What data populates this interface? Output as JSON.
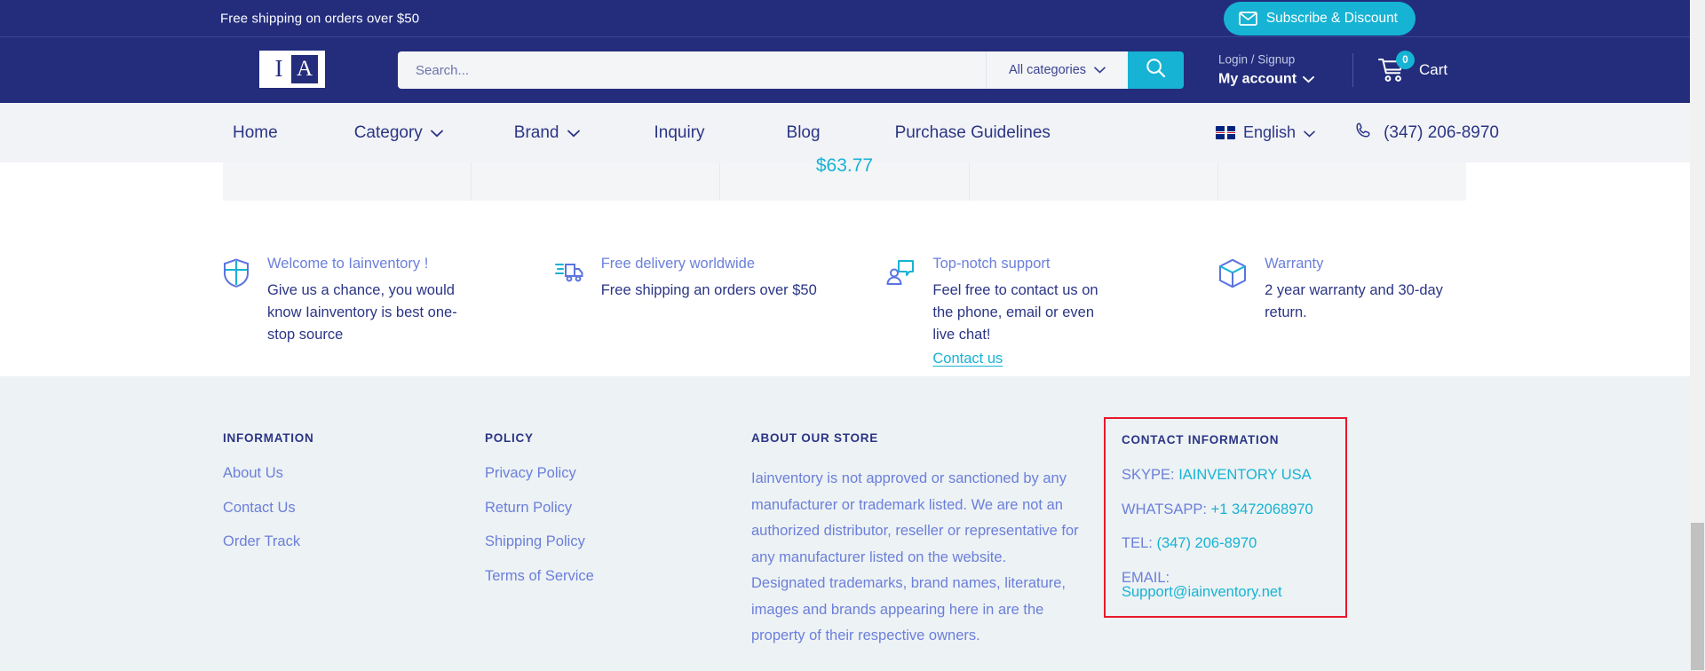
{
  "announcement": {
    "text": "Free shipping on orders over $50",
    "subscribe_label": "Subscribe & Discount",
    "mail_icon": "envelope-icon"
  },
  "header": {
    "logo_left": "I",
    "logo_right": "A",
    "search_placeholder": "Search...",
    "search_value": "",
    "category_label": "All categories",
    "search_icon": "magnifier-icon",
    "account_top": "Login / Signup",
    "account_bottom": "My account",
    "cart_label": "Cart",
    "cart_count": "0"
  },
  "nav": {
    "items": [
      {
        "label": "Home",
        "caret": false
      },
      {
        "label": "Category",
        "caret": true
      },
      {
        "label": "Brand",
        "caret": true
      },
      {
        "label": "Inquiry",
        "caret": false
      },
      {
        "label": "Blog",
        "caret": false
      },
      {
        "label": "Purchase Guidelines",
        "caret": false
      }
    ],
    "language": "English",
    "phone": "(347) 206-8970"
  },
  "content": {
    "price": "$63.77"
  },
  "features": [
    {
      "icon": "shield-icon",
      "title": "Welcome to Iainventory !",
      "desc": "Give us a chance, you would know Iainventory is best one-stop source",
      "link": ""
    },
    {
      "icon": "delivery-truck-icon",
      "title": "Free delivery worldwide",
      "desc": "Free shipping an orders over $50",
      "link": ""
    },
    {
      "icon": "support-chat-icon",
      "title": "Top-notch support",
      "desc": "Feel free to contact us on the phone, email or even live chat!",
      "link": "Contact us"
    },
    {
      "icon": "package-box-icon",
      "title": "Warranty",
      "desc": "2 year warranty and 30-day return.",
      "link": ""
    }
  ],
  "footer": {
    "information": {
      "heading": "INFORMATION",
      "links": [
        "About Us",
        "Contact Us",
        "Order Track"
      ]
    },
    "policy": {
      "heading": "POLICY",
      "links": [
        "Privacy Policy",
        "Return Policy",
        "Shipping Policy",
        "Terms of Service"
      ]
    },
    "about": {
      "heading": "ABOUT OUR STORE",
      "text": "Iainventory is not approved or sanctioned by any manufacturer or trademark listed. We are not an authorized distributor, reseller or representative for any manufacturer listed on the website. Designated trademarks, brand names, literature, images and brands appearing here in are the property of their respective owners."
    },
    "contact": {
      "heading": "CONTACT INFORMATION",
      "lines": [
        {
          "label": "SKYPE:",
          "value": "IAINVENTORY USA"
        },
        {
          "label": "WHATSAPP:",
          "value": "+1 3472068970"
        },
        {
          "label": "TEL:",
          "value": "(347) 206-8970"
        },
        {
          "label": "EMAIL:",
          "value": "Support@iainventory.net"
        }
      ],
      "highlight_color": "#e8192c"
    }
  },
  "colors": {
    "brand_navy": "#232d7c",
    "accent_cyan": "#17b3d4",
    "link_periwinkle": "#6b7fdb",
    "footer_bg": "#edf2f4"
  }
}
